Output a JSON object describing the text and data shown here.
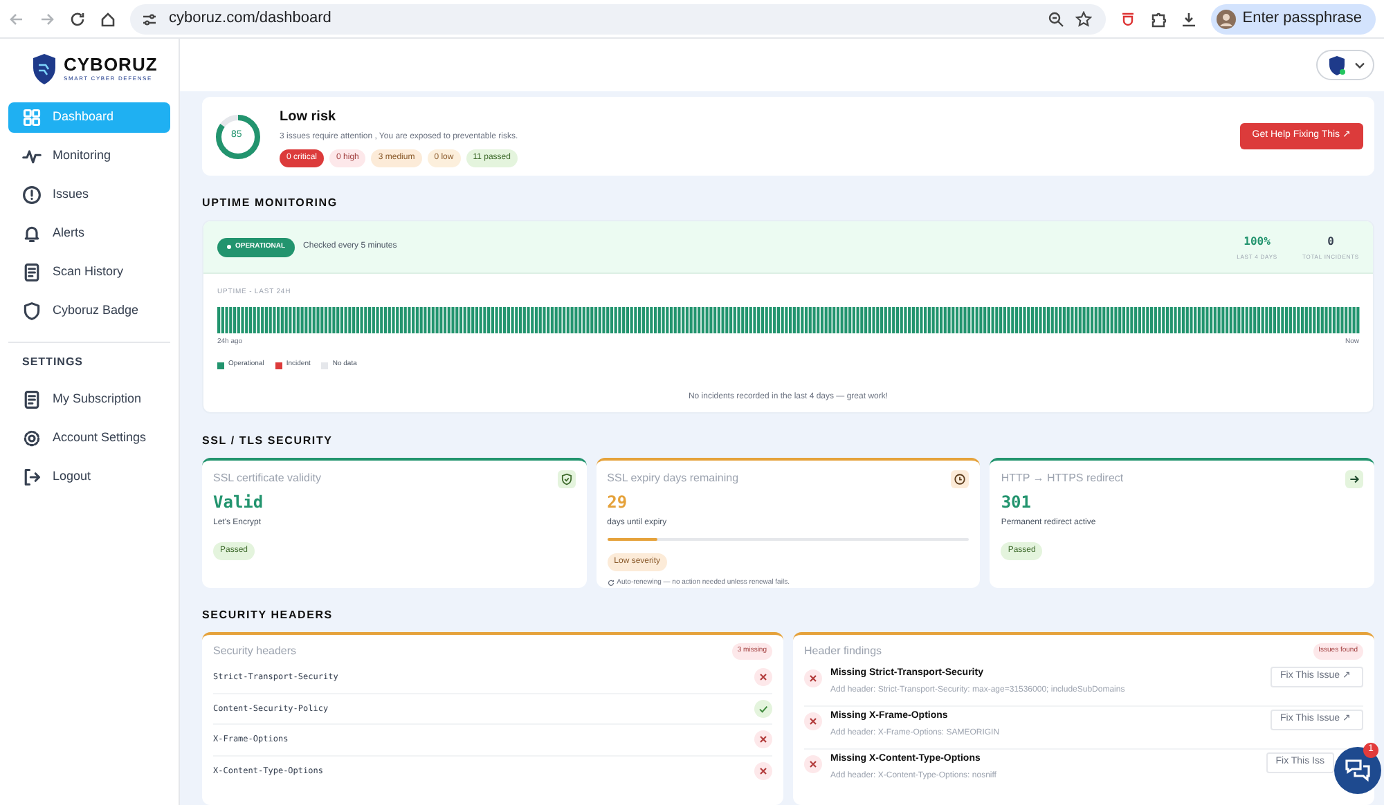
{
  "browser": {
    "url": "cyboruz.com/dashboard",
    "profile": "Enter passphrase"
  },
  "sidebar": {
    "logo": {
      "name": "CYBORUZ",
      "tagline": "SMART CYBER DEFENSE"
    },
    "items": [
      {
        "label": "Dashboard",
        "selected": true
      },
      {
        "label": "Monitoring",
        "selected": false
      },
      {
        "label": "Issues",
        "selected": false
      },
      {
        "label": "Alerts",
        "selected": false
      },
      {
        "label": "Scan History",
        "selected": false
      },
      {
        "label": "Cyboruz Badge",
        "selected": false
      }
    ],
    "settings_heading": "SETTINGS",
    "settings_items": [
      {
        "label": "My Subscription",
        "selected": false
      },
      {
        "label": "Account Settings",
        "selected": false
      },
      {
        "label": "Logout",
        "selected": false
      }
    ]
  },
  "risk": {
    "score": "85",
    "level": 0.85,
    "title": "Low risk",
    "summary": "3 issues require attention , You are exposed to preventable risks.",
    "badges": [
      {
        "label": "0 critical",
        "kind": "critical"
      },
      {
        "label": "0 high",
        "kind": "high"
      },
      {
        "label": "3 medium",
        "kind": "medium"
      },
      {
        "label": "0 low",
        "kind": "low"
      },
      {
        "label": "11 passed",
        "kind": "passed"
      }
    ],
    "button": "Get Help Fixing This ↗"
  },
  "uptime": {
    "heading": "UPTIME MONITORING",
    "status": "OPERATIONAL",
    "check_note": "Checked every 5 minutes",
    "stats": [
      {
        "value": "100%",
        "label": "LAST 4 DAYS",
        "kind": "good"
      },
      {
        "value": "0",
        "label": "TOTAL INCIDENTS",
        "kind": "neutral"
      }
    ],
    "bar_title": "UPTIME - LAST 24H",
    "start_label": "24h ago",
    "end_label": "Now",
    "legend": [
      {
        "label": "Operational",
        "color": "#22946e"
      },
      {
        "label": "Incident",
        "color": "#dc3b3b"
      },
      {
        "label": "No data",
        "color": "#e5e7eb"
      }
    ],
    "note": "No incidents recorded in the last 4 days — great work!"
  },
  "ssl": {
    "heading": "SSL / TLS SECURITY",
    "cards": [
      {
        "title": "SSL certificate validity",
        "kind": "passed",
        "value": "Valid",
        "caption": "Let's Encrypt",
        "badge": "Passed"
      },
      {
        "title": "SSL expiry days remaining",
        "kind": "warning",
        "value": "29",
        "caption": "days until expiry",
        "level": 0.14,
        "badge": "Low severity",
        "note": "Auto-renewing — no action needed unless renewal fails."
      },
      {
        "title": "HTTP → HTTPS redirect",
        "kind": "passed",
        "value": "301",
        "caption": "Permanent redirect active",
        "badge": "Passed"
      }
    ]
  },
  "headers": {
    "heading": "SECURITY HEADERS",
    "list_title": "Security headers",
    "list_badge": "3 missing",
    "items": [
      {
        "name": "Strict-Transport-Security",
        "present": false
      },
      {
        "name": "Content-Security-Policy",
        "present": true
      },
      {
        "name": "X-Frame-Options",
        "present": false
      },
      {
        "name": "X-Content-Type-Options",
        "present": false
      }
    ],
    "findings_title": "Header findings",
    "findings_badge": "Issues found",
    "findings": [
      {
        "title": "Missing Strict-Transport-Security",
        "detail": "Add header: Strict-Transport-Security: max-age=31536000; includeSubDomains",
        "button": "Fix This Issue ↗"
      },
      {
        "title": "Missing X-Frame-Options",
        "detail": "Add header: X-Frame-Options: SAMEORIGIN",
        "button": "Fix This Issue ↗"
      },
      {
        "title": "Missing X-Content-Type-Options",
        "detail": "Add header: X-Content-Type-Options: nosniff",
        "button": "Fix This Iss"
      }
    ]
  },
  "chat": {
    "badge": "1"
  }
}
